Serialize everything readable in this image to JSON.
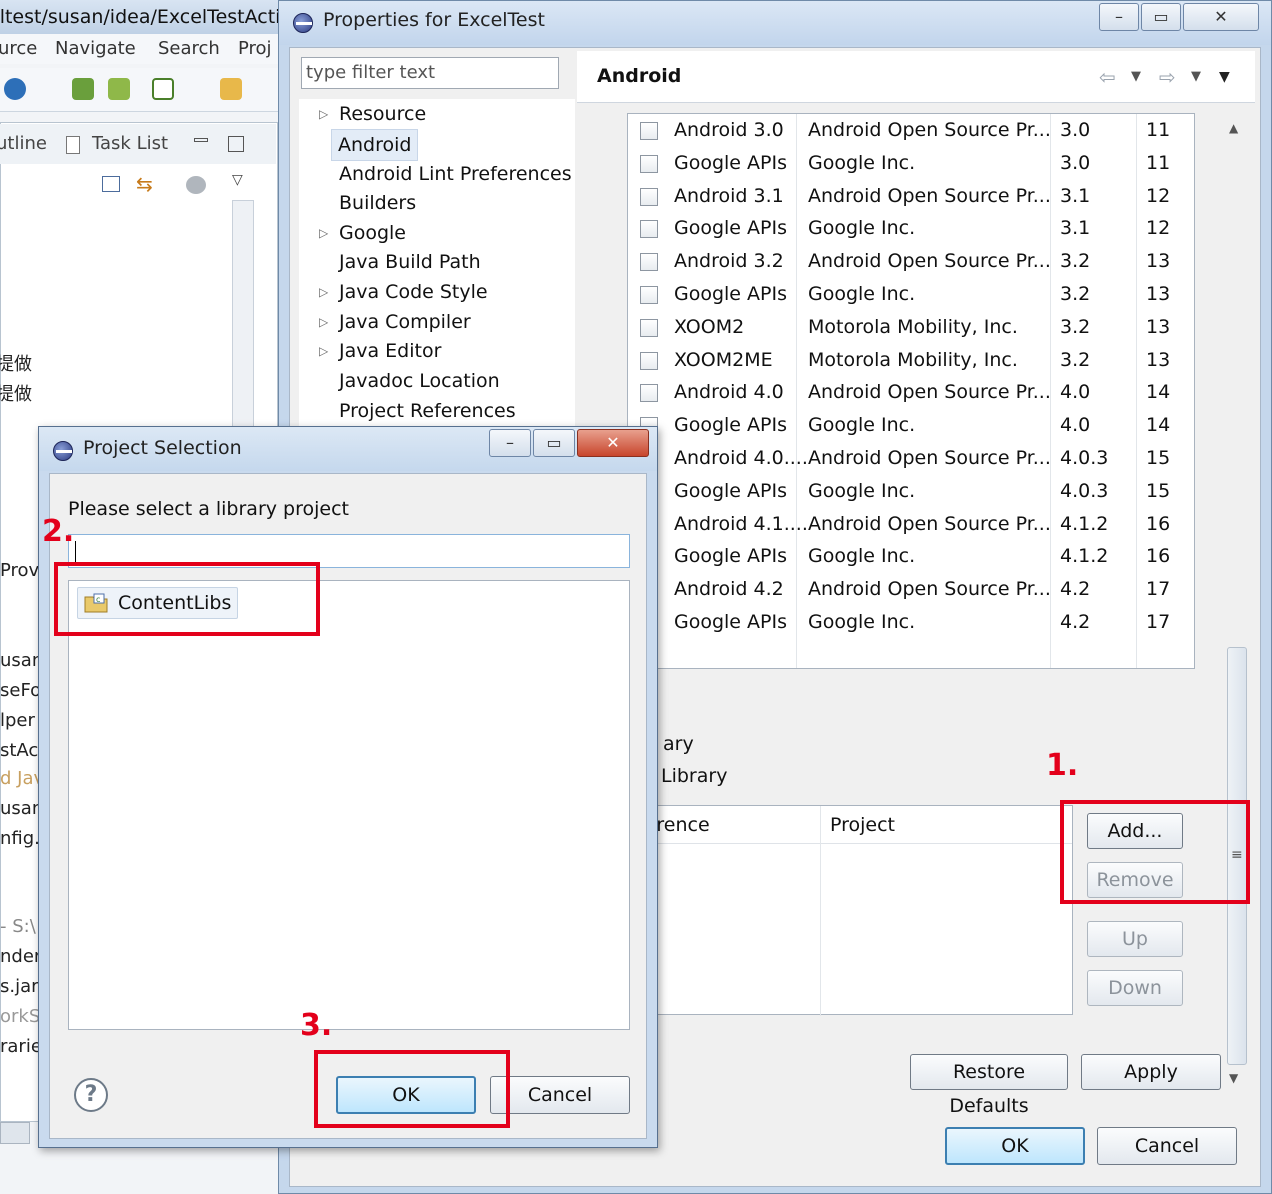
{
  "background": {
    "title": "eltest/susan/idea/ExcelTestActiv",
    "menu": [
      "urce",
      "Navigate",
      "Search",
      "Proj"
    ],
    "view_tabs": [
      "utline",
      "Task List"
    ],
    "side_fragments": [
      "提做",
      "提做",
      "Prov",
      "usan.",
      "seFo",
      "lper",
      "stAct",
      "d Jav",
      "usan.",
      "nfig.",
      "- S:\\",
      "nder",
      "s.jar",
      "orkS",
      "rarie"
    ]
  },
  "properties_dialog": {
    "title": "Properties for ExcelTest",
    "filter_placeholder": "type filter text",
    "tree": [
      {
        "label": "Resource",
        "expandable": true
      },
      {
        "label": "Android",
        "expandable": false,
        "selected": true
      },
      {
        "label": "Android Lint Preferences",
        "expandable": false
      },
      {
        "label": "Builders",
        "expandable": false
      },
      {
        "label": "Google",
        "expandable": true
      },
      {
        "label": "Java Build Path",
        "expandable": false
      },
      {
        "label": "Java Code Style",
        "expandable": true
      },
      {
        "label": "Java Compiler",
        "expandable": true
      },
      {
        "label": "Java Editor",
        "expandable": true
      },
      {
        "label": "Javadoc Location",
        "expandable": false
      },
      {
        "label": "Project References",
        "expandable": false
      }
    ],
    "page_title": "Android",
    "targets": [
      {
        "name": "Android 3.0",
        "vendor": "Android Open Source Pr...",
        "platform": "3.0",
        "api": "11"
      },
      {
        "name": "Google APIs",
        "vendor": "Google Inc.",
        "platform": "3.0",
        "api": "11"
      },
      {
        "name": "Android 3.1",
        "vendor": "Android Open Source Pr...",
        "platform": "3.1",
        "api": "12"
      },
      {
        "name": "Google APIs",
        "vendor": "Google Inc.",
        "platform": "3.1",
        "api": "12"
      },
      {
        "name": "Android 3.2",
        "vendor": "Android Open Source Pr...",
        "platform": "3.2",
        "api": "13"
      },
      {
        "name": "Google APIs",
        "vendor": "Google Inc.",
        "platform": "3.2",
        "api": "13"
      },
      {
        "name": "XOOM2",
        "vendor": "Motorola Mobility, Inc.",
        "platform": "3.2",
        "api": "13"
      },
      {
        "name": "XOOM2ME",
        "vendor": "Motorola Mobility, Inc.",
        "platform": "3.2",
        "api": "13"
      },
      {
        "name": "Android 4.0",
        "vendor": "Android Open Source Pr...",
        "platform": "4.0",
        "api": "14"
      },
      {
        "name": "Google APIs",
        "vendor": "Google Inc.",
        "platform": "4.0",
        "api": "14"
      },
      {
        "name": "Android 4.0....",
        "vendor": "Android Open Source Pr...",
        "platform": "4.0.3",
        "api": "15"
      },
      {
        "name": "Google APIs",
        "vendor": "Google Inc.",
        "platform": "4.0.3",
        "api": "15"
      },
      {
        "name": "Android 4.1....",
        "vendor": "Android Open Source Pr...",
        "platform": "4.1.2",
        "api": "16"
      },
      {
        "name": "Google APIs",
        "vendor": "Google Inc.",
        "platform": "4.1.2",
        "api": "16"
      },
      {
        "name": "Android 4.2",
        "vendor": "Android Open Source Pr...",
        "platform": "4.2",
        "api": "17"
      },
      {
        "name": "Google APIs",
        "vendor": "Google Inc.",
        "platform": "4.2",
        "api": "17"
      }
    ],
    "library_group_label": "ary",
    "library_checkbox_label": "Library",
    "library_columns": [
      "ference",
      "Project"
    ],
    "buttons": {
      "add": "Add...",
      "remove": "Remove",
      "up": "Up",
      "down": "Down",
      "restore_defaults": "Restore Defaults",
      "apply": "Apply",
      "ok": "OK",
      "cancel": "Cancel"
    }
  },
  "project_selection": {
    "title": "Project Selection",
    "prompt": "Please select a library project",
    "search_value": "",
    "projects": [
      "ContentLibs"
    ],
    "ok": "OK",
    "cancel": "Cancel",
    "help": "?"
  },
  "annotations": [
    "1.",
    "2.",
    "3."
  ],
  "colors": {
    "annotation": "#e3001b",
    "selection": "#e3ecf7",
    "default_button": "#3c7fb1"
  }
}
